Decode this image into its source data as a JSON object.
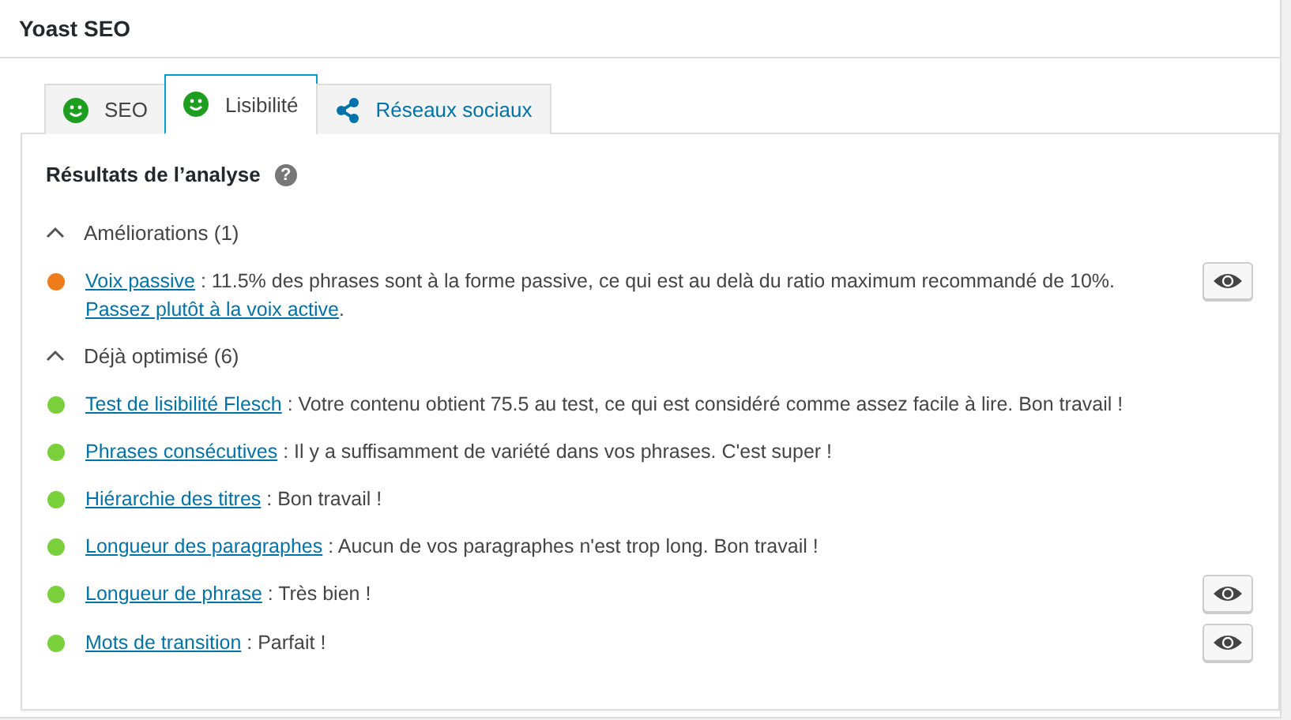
{
  "panel": {
    "title": "Yoast SEO"
  },
  "tabs": [
    {
      "label": "SEO",
      "kind": "smiley",
      "selected": false
    },
    {
      "label": "Lisibilité",
      "kind": "smiley",
      "selected": true
    },
    {
      "label": "Réseaux sociaux",
      "kind": "share",
      "selected": false
    }
  ],
  "analysis": {
    "title": "Résultats de l’analyse",
    "help": "?",
    "sections": [
      {
        "heading": "Améliorations (1)",
        "expanded": true,
        "results": [
          {
            "color": "#ee7c1b",
            "link": "Voix passive",
            "text": " : 11.5% des phrases sont à la forme passive, ce qui est au delà du ratio maximum recommandé de 10%.",
            "extra_link": "Passez plutôt à la voix active",
            "extra_after": ".",
            "marker": true
          }
        ]
      },
      {
        "heading": "Déjà optimisé (6)",
        "expanded": true,
        "results": [
          {
            "color": "#7ad03a",
            "link": "Test de lisibilité Flesch",
            "text": " : Votre contenu obtient 75.5 au test, ce qui est considéré comme assez facile à lire. Bon travail !",
            "marker": false
          },
          {
            "color": "#7ad03a",
            "link": "Phrases consécutives",
            "text": " : Il y a suffisamment de variété dans vos phrases. C'est super !",
            "marker": false
          },
          {
            "color": "#7ad03a",
            "link": "Hiérarchie des titres",
            "text": " : Bon travail !",
            "marker": false
          },
          {
            "color": "#7ad03a",
            "link": "Longueur des paragraphes",
            "text": " : Aucun de vos paragraphes n'est trop long. Bon travail !",
            "marker": false
          },
          {
            "color": "#7ad03a",
            "link": "Longueur de phrase",
            "text": " : Très bien !",
            "marker": true
          },
          {
            "color": "#7ad03a",
            "link": "Mots de transition",
            "text": " : Parfait !",
            "marker": true
          }
        ]
      }
    ]
  }
}
